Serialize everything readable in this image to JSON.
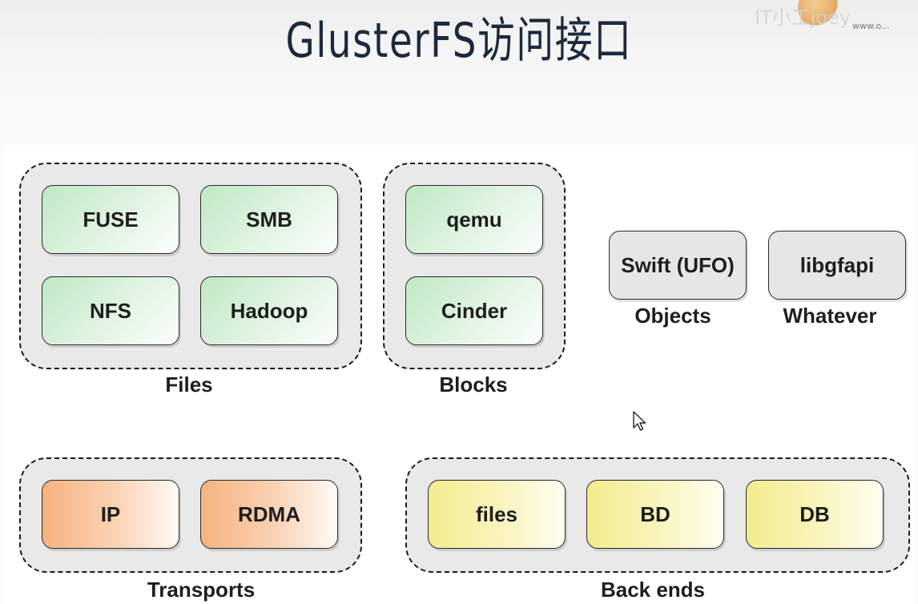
{
  "title": "GlusterFS访问接口",
  "watermark": {
    "text": "IT小工joey",
    "url": "www.o..."
  },
  "groups": {
    "files": {
      "label": "Files",
      "items": [
        "FUSE",
        "SMB",
        "NFS",
        "Hadoop"
      ]
    },
    "blocks": {
      "label": "Blocks",
      "items": [
        "qemu",
        "Cinder"
      ]
    },
    "objects": {
      "label": "Objects",
      "item": "Swift (UFO)"
    },
    "whatever": {
      "label": "Whatever",
      "item": "libgfapi"
    },
    "transports": {
      "label": "Transports",
      "items": [
        "IP",
        "RDMA"
      ]
    },
    "backends": {
      "label": "Back ends",
      "items": [
        "files",
        "BD",
        "DB"
      ]
    }
  },
  "colors": {
    "interface_fill": "#d4efd7",
    "transport_fill": "#f7c39b",
    "backend_fill": "#f6f0a4",
    "group_fill": "#e9e9e9",
    "title_color": "#1b2a3e"
  },
  "icons": {
    "cursor": "mouse-pointer-icon"
  }
}
